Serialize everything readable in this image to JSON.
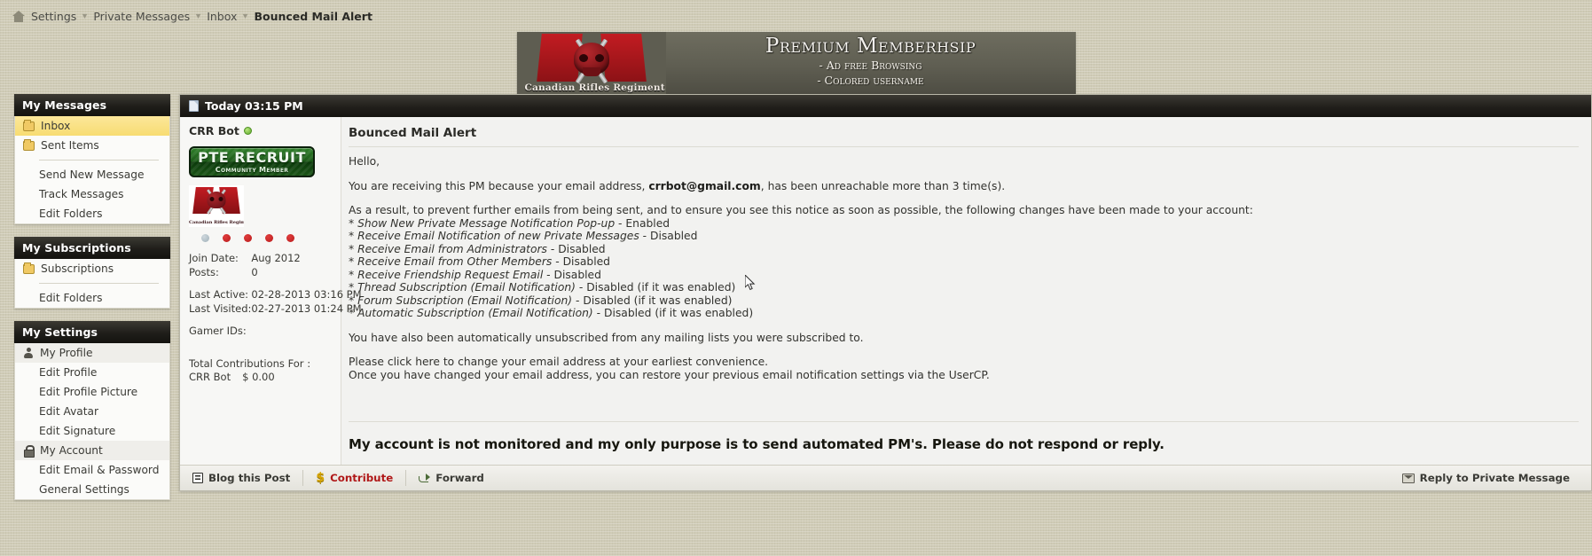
{
  "breadcrumb": {
    "home_icon": "home-icon",
    "items": [
      {
        "label": "Settings"
      },
      {
        "label": "Private Messages"
      },
      {
        "label": "Inbox"
      },
      {
        "label": "Bounced Mail Alert"
      }
    ],
    "separator": "▼"
  },
  "banner": {
    "title": "Premium Memberhsip",
    "line1": "- Ad free Browsing",
    "line2": "- Colored username",
    "logo_text": "Canadian Rifles Regiment"
  },
  "sidebar": {
    "blocks": [
      {
        "title": "My Messages",
        "items": [
          {
            "label": "Inbox",
            "icon": "folder-icon",
            "state": "selected"
          },
          {
            "label": "Sent Items",
            "icon": "folder-icon",
            "state": "normal"
          },
          {
            "label": "Send New Message",
            "icon": "none",
            "state": "sub"
          },
          {
            "label": "Track Messages",
            "icon": "none",
            "state": "sub"
          },
          {
            "label": "Edit Folders",
            "icon": "none",
            "state": "sub"
          }
        ]
      },
      {
        "title": "My Subscriptions",
        "items": [
          {
            "label": "Subscriptions",
            "icon": "folder-icon",
            "state": "normal"
          },
          {
            "label": "Edit Folders",
            "icon": "none",
            "state": "sub"
          }
        ]
      },
      {
        "title": "My Settings",
        "items": [
          {
            "label": "My Profile",
            "icon": "person-icon",
            "state": "highlight"
          },
          {
            "label": "Edit Profile",
            "icon": "none",
            "state": "sub"
          },
          {
            "label": "Edit Profile Picture",
            "icon": "none",
            "state": "sub"
          },
          {
            "label": "Edit Avatar",
            "icon": "none",
            "state": "sub"
          },
          {
            "label": "Edit Signature",
            "icon": "none",
            "state": "sub"
          },
          {
            "label": "My Account",
            "icon": "lock-icon",
            "state": "highlight"
          },
          {
            "label": "Edit Email & Password",
            "icon": "none",
            "state": "sub"
          },
          {
            "label": "General Settings",
            "icon": "none",
            "state": "sub"
          }
        ]
      }
    ]
  },
  "message": {
    "header_timestamp": "Today 03:15 PM",
    "title": "Bounced Mail Alert",
    "author": {
      "name": "CRR Bot",
      "online_status": "online",
      "rank_title": "PTE RECRUIT",
      "rank_subtitle": "Community Member",
      "avatar_caption": "Canadian Rifles Regiment",
      "reputation_dots": [
        "gray",
        "red",
        "red",
        "red",
        "red"
      ],
      "stats": [
        {
          "key": "Join Date:",
          "value": "Aug 2012"
        },
        {
          "key": "Posts:",
          "value": "0"
        },
        {
          "key": "Last Active:",
          "value": "02-28-2013 03:16 PM"
        },
        {
          "key": "Last Visited:",
          "value": "02-27-2013 01:24 PM"
        },
        {
          "key": "Gamer IDs:",
          "value": ""
        }
      ],
      "contributions_header": "Total Contributions For :",
      "contributions_name": "CRR Bot",
      "contributions_amount": "$ 0.00"
    },
    "body": {
      "greeting": "Hello,",
      "para1_pre": "You are receiving this PM because your email address, ",
      "para1_email": "crrbot@gmail.com",
      "para1_post": ", has been unreachable more than 3 time(s).",
      "para2": "As a result, to prevent further emails from being sent, and to ensure you see this notice as soon as possible, the following changes have been made to your account:",
      "settings": [
        {
          "name": "Show New Private Message Notification Pop-up",
          "value": " - Enabled"
        },
        {
          "name": "Receive Email Notification of new Private Messages",
          "value": " - Disabled"
        },
        {
          "name": "Receive Email from Administrators",
          "value": " - Disabled"
        },
        {
          "name": "Receive Email from Other Members",
          "value": " - Disabled"
        },
        {
          "name": "Receive Friendship Request Email",
          "value": " - Disabled"
        },
        {
          "name": "Thread Subscription (Email Notification)",
          "value": " - Disabled (if it was enabled)"
        },
        {
          "name": "Forum Subscription (Email Notification)",
          "value": " - Disabled (if it was enabled)"
        },
        {
          "name": "Automatic Subscription (Email Notification)",
          "value": " - Disabled (if it was enabled)"
        }
      ],
      "para3": "You have also been automatically unsubscribed from any mailing lists you were subscribed to.",
      "para4_line1": "Please click here to change your email address at your earliest convenience.",
      "para4_line2": "Once you have changed your email address, you can restore your previous email notification settings via the UserCP.",
      "signature": "My account is not monitored and my only purpose is to send automated PM's. Please do not respond or reply."
    },
    "footer": {
      "blog_label": "Blog this Post",
      "contribute_label": "Contribute",
      "forward_label": "Forward",
      "reply_label": "Reply to Private Message"
    }
  },
  "colors": {
    "page_bg": "#cfcbb6",
    "header_bar": "#1f1e1a",
    "selected_nav": "#f7dc72",
    "contribute_red": "#b01818",
    "online_green": "#5da82b"
  }
}
